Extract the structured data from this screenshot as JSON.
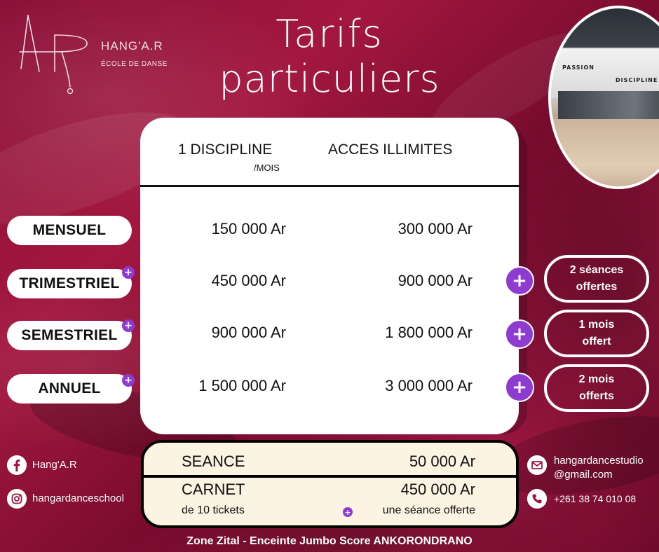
{
  "brand": {
    "name": "HANG'A.R",
    "subtitle": "ÉCOLE DE DANSE",
    "logo_letters": "AR"
  },
  "title": {
    "line1": "Tarifs",
    "line2": "particuliers"
  },
  "photo": {
    "words": [
      "PASSION",
      "DISCIPLINE"
    ]
  },
  "table": {
    "headers": {
      "col1": "1 DISCIPLINE",
      "col1_sub": "/MOIS",
      "col2": "ACCES ILLIMITES"
    },
    "rows": [
      {
        "label": "MENSUEL",
        "discipline": "150 000 Ar",
        "illimite": "300 000 Ar",
        "plus": false
      },
      {
        "label": "TRIMESTRIEL",
        "discipline": "450 000 Ar",
        "illimite": "900 000 Ar",
        "plus": true,
        "plus_symbol": "+",
        "offer": "2 séances\noffertes"
      },
      {
        "label": "SEMESTRIEL",
        "discipline": "900 000 Ar",
        "illimite": "1 800 000 Ar",
        "plus": true,
        "plus_symbol": "+",
        "offer": "1 mois\noffert"
      },
      {
        "label": "ANNUEL",
        "discipline": "1 500 000 Ar",
        "illimite": "3 000 000 Ar",
        "plus": true,
        "plus_symbol": "+",
        "offer": "2 mois\nofferts"
      }
    ]
  },
  "seance": {
    "label": "SEANCE",
    "price": "50 000 Ar",
    "carnet_label": "CARNET",
    "carnet_sub": "de 10 tickets",
    "carnet_price": "450 000 Ar",
    "carnet_bonus": "une séance offerte",
    "bonus_symbol": "+"
  },
  "socials": {
    "facebook": {
      "icon": "facebook-icon",
      "text": "Hang'A.R"
    },
    "instagram": {
      "icon": "instagram-icon",
      "text": "hangardanceschool"
    },
    "email": {
      "icon": "mail-icon",
      "line1": "hangardancestudio",
      "line2": "@gmail.com"
    },
    "phone": {
      "icon": "phone-icon",
      "text": "+261 38 74 010 08"
    }
  },
  "footer": "Zone Zital - Enceinte Jumbo Score ANKORONDRANO",
  "colors": {
    "background": "#9b1540",
    "accent_purple": "#8e3bd0",
    "card": "#ffffff",
    "seance_bg": "#fdf3e3"
  }
}
